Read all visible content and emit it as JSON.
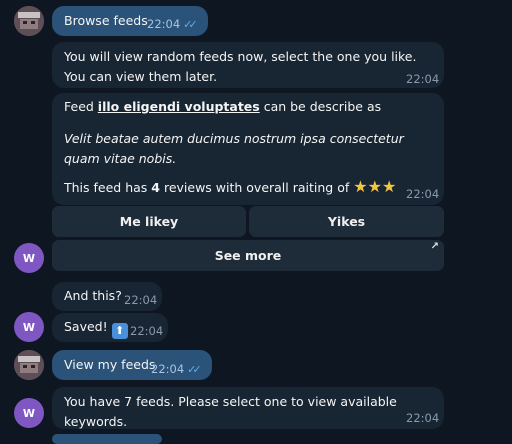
{
  "messages": {
    "m1": {
      "text": "Browse feeds",
      "time": "22:04"
    },
    "m2": {
      "text": "You will view random feeds now, select the one you like. You can view them later.",
      "time": "22:04"
    },
    "m3": {
      "prefix": "Feed ",
      "link": "illo eligendi voluptates",
      "suffix": " can be describe as",
      "description": "Velit beatae autem ducimus nostrum ipsa consectetur quam vitae nobis.",
      "reviews_prefix": "This feed has ",
      "reviews_count": "4",
      "reviews_suffix": " reviews with overall raiting of",
      "stars": 3,
      "time": "22:04"
    },
    "m4": {
      "text": "And this?",
      "time": "22:04"
    },
    "m5": {
      "text": "Saved!",
      "time": "22:04"
    },
    "m6": {
      "text": "View my feeds",
      "time": "22:04"
    },
    "m7": {
      "text": "You have 7 feeds. Please select one to view available keywords.",
      "time": "22:04"
    }
  },
  "keyboard": {
    "like_label": "Me likey",
    "yikes_label": "Yikes",
    "see_more_label": "See more"
  },
  "bot_avatar_letter": "W",
  "colors": {
    "background": "#0e1621",
    "incoming": "#182533",
    "outgoing": "#2b5278",
    "accent": "#7e57c2"
  }
}
